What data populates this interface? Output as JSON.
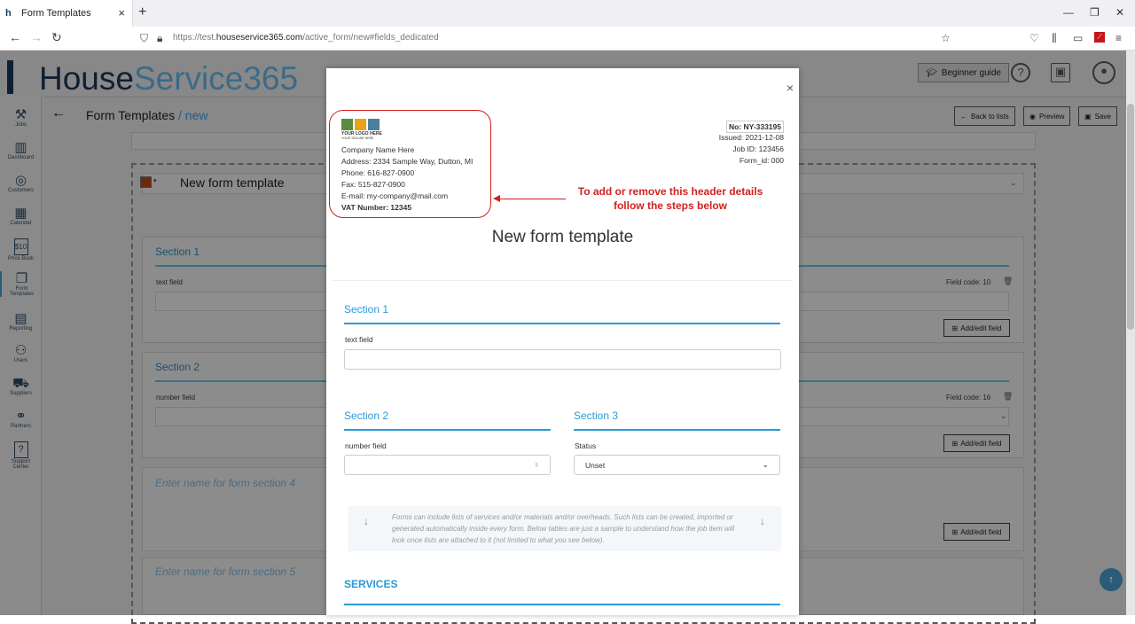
{
  "browser": {
    "tab_title": "Form Templates",
    "tab_close": "×",
    "new_tab": "+",
    "url_prefix": "https://test.",
    "url_domain": "houseservice365.com",
    "url_path": "/active_form/new#fields_dedicated",
    "win_minimize": "—",
    "win_restore": "❐",
    "win_close": "✕"
  },
  "app": {
    "brand_house": "House",
    "brand_service": "Service365",
    "beginner_guide": "Beginner guide",
    "help": "?",
    "breadcrumb_root": "Form Templates",
    "breadcrumb_current": " / new",
    "toolbar": {
      "back_to_lists": "Back to lists",
      "preview": "Preview",
      "save": "Save"
    }
  },
  "sidebar": {
    "items": [
      {
        "label": "Jobs",
        "icon": "⚒"
      },
      {
        "label": "Dashboard",
        "icon": "▥"
      },
      {
        "label": "Customers",
        "icon": "◎"
      },
      {
        "label": "Calendar",
        "icon": "▦"
      },
      {
        "label": "Price Book",
        "icon": "$10"
      },
      {
        "label": "Form\nTemplates",
        "icon": "❐"
      },
      {
        "label": "Reporting",
        "icon": "▤"
      },
      {
        "label": "Users",
        "icon": "⚇"
      },
      {
        "label": "Suppliers",
        "icon": "⛟"
      },
      {
        "label": "Partners",
        "icon": "⚭"
      },
      {
        "label": "Support\nCenter",
        "icon": "?"
      }
    ]
  },
  "background_form": {
    "title": "New form template",
    "section1": {
      "title": "Section 1",
      "field_label": "text field",
      "field_code": "Field code: 10"
    },
    "section2": {
      "title": "Section 2",
      "field_label": "number field",
      "field_code": "Field code: 16"
    },
    "section4_placeholder": "Enter name for form section 4",
    "section5_placeholder": "Enter name for form section 5",
    "add_edit_label": "Add/edit field"
  },
  "modal": {
    "close": "×",
    "logo_line1": "YOUR LOGO HERE",
    "logo_line2": "YOUR TAGLINE HERE",
    "company_name": "Company Name Here",
    "address": "Address: 2334 Sample Way, Dutton, MI",
    "phone": "Phone: 616-827-0900",
    "fax": "Fax: 515-827-0900",
    "email": "E-mail: my-company@mail.com",
    "vat": "VAT Number: 12345",
    "doc_no": "No: NY-333195",
    "issued": "Issued: 2021-12-08",
    "job_id": "Job ID: 123456",
    "form_id": "Form_id: 000",
    "annotation": "To add or remove this header details follow the steps below",
    "form_title": "New form template",
    "section1": "Section 1",
    "text_field_label": "text field",
    "section2": "Section 2",
    "number_field_label": "number field",
    "section3": "Section 3",
    "status_label": "Status",
    "status_value": "Unset",
    "info_text": "Forms can include lists of services and/or materials and/or overheads. Such lists can be created, imported or generated automatically inside every form. Below tables are just a sample to understand how the job item will look once lists are attached to it (not limited to what you see below).",
    "services": "SERVICES"
  },
  "colors": {
    "accent": "#2a9bd7",
    "annotation": "#d32020",
    "brand_dark": "#0f1f33"
  }
}
